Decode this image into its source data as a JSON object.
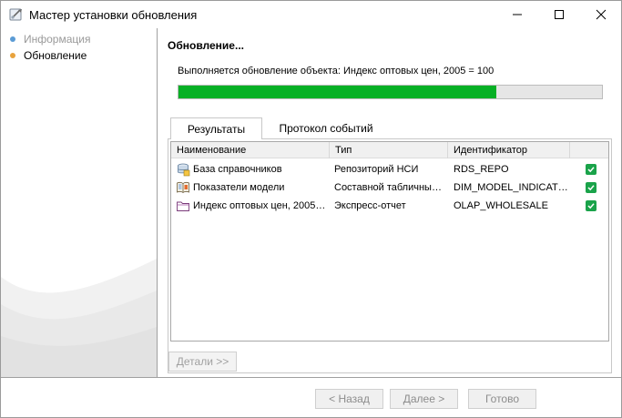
{
  "window": {
    "title": "Мастер установки обновления"
  },
  "sidebar": {
    "items": [
      {
        "label": "Информация",
        "state": "inactive",
        "dot_color": "#5b9bd5"
      },
      {
        "label": "Обновление",
        "state": "active",
        "dot_color": "#e8a33d"
      }
    ]
  },
  "main": {
    "title": "Обновление...",
    "status": "Выполняется обновление объекта: Индекс оптовых цен, 2005 = 100",
    "progress_percent": 75,
    "progress_color": "#06b025"
  },
  "tabs": [
    {
      "label": "Результаты",
      "selected": true
    },
    {
      "label": "Протокол событий",
      "selected": false
    }
  ],
  "grid": {
    "columns": [
      "Наименование",
      "Тип",
      "Идентификатор",
      ""
    ],
    "rows": [
      {
        "icon": "database-icon",
        "name": "База справочников",
        "type": "Репозиторий НСИ",
        "id": "RDS_REPO",
        "checked": true
      },
      {
        "icon": "book-icon",
        "name": "Показатели модели",
        "type": "Составной табличный…",
        "id": "DIM_MODEL_INDICAT…",
        "checked": true
      },
      {
        "icon": "folder-icon",
        "name": "Индекс оптовых цен, 2005…",
        "type": "Экспресс-отчет",
        "id": "OLAP_WHOLESALE",
        "checked": true
      }
    ]
  },
  "buttons": {
    "details": "Детали >>",
    "back": "< Назад",
    "next": "Далее >",
    "done": "Готово"
  }
}
